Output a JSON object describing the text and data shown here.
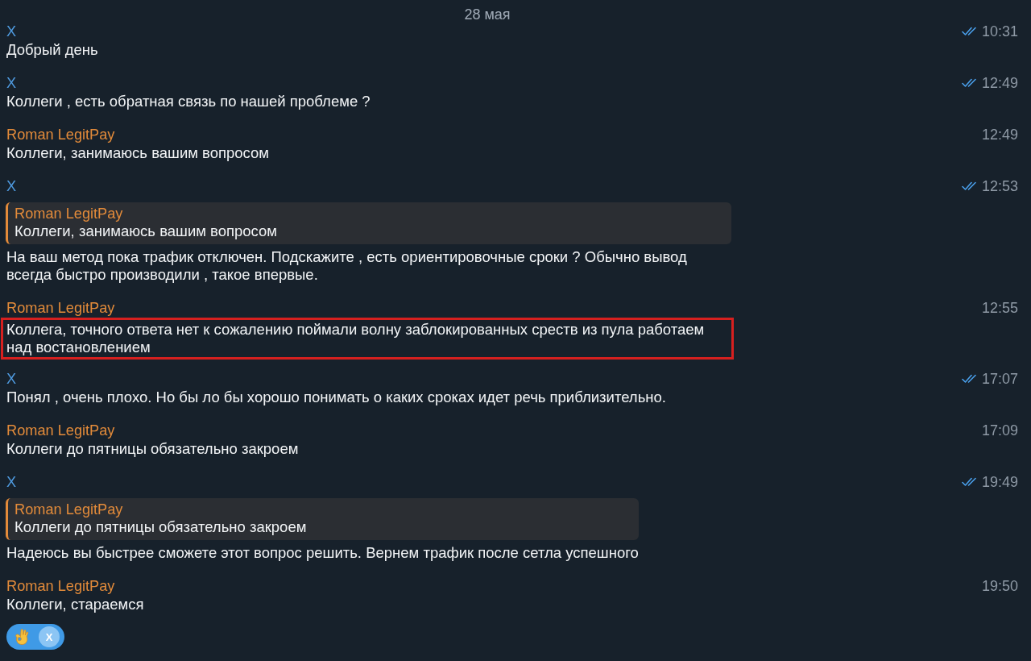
{
  "date_separator": "28 мая",
  "messages": [
    {
      "sender": "X",
      "color": "#4f9be0",
      "time": "10:31",
      "read": true,
      "highlighted": false,
      "text": "Добрый день"
    },
    {
      "sender": "X",
      "color": "#4f9be0",
      "time": "12:49",
      "read": true,
      "highlighted": false,
      "text": "Коллеги , есть обратная связь по нашей проблеме ?"
    },
    {
      "sender": "Roman LegitPay",
      "color": "#e38b3a",
      "time": "12:49",
      "read": false,
      "highlighted": false,
      "text": "Коллеги, занимаюсь вашим вопросом"
    },
    {
      "sender": "X",
      "color": "#4f9be0",
      "time": "12:53",
      "read": true,
      "highlighted": false,
      "reply": {
        "sender": "Roman LegitPay",
        "color": "#e38b3a",
        "text": "Коллеги, занимаюсь вашим вопросом"
      },
      "text": "На ваш метод пока трафик отключен. Подскажите , есть ориентировочные сроки ? Обычно вывод всегда быстро производили , такое впервые."
    },
    {
      "sender": "Roman LegitPay",
      "color": "#e38b3a",
      "time": "12:55",
      "read": false,
      "highlighted": true,
      "text": "Коллега, точного ответа нет к сожалению поймали волну заблокированных среств из пула работаем над востановлением"
    },
    {
      "sender": "X",
      "color": "#4f9be0",
      "time": "17:07",
      "read": true,
      "highlighted": false,
      "text": "Понял , очень плохо. Но бы ло бы хорошо понимать о каких сроках идет речь приблизительно."
    },
    {
      "sender": "Roman LegitPay",
      "color": "#e38b3a",
      "time": "17:09",
      "read": false,
      "highlighted": false,
      "text": "Коллеги до пятницы обязательно закроем"
    },
    {
      "sender": "X",
      "color": "#4f9be0",
      "time": "19:49",
      "read": true,
      "highlighted": false,
      "reply": {
        "sender": "Roman LegitPay",
        "color": "#e38b3a",
        "text": "Коллеги до пятницы обязательно закроем"
      },
      "text": "Надеюсь вы быстрее сможете этот вопрос решить. Вернем трафик после сетла успешного"
    },
    {
      "sender": "Roman LegitPay",
      "color": "#e38b3a",
      "time": "19:50",
      "read": false,
      "highlighted": false,
      "text": "Коллеги, стараемся",
      "reactions": [
        {
          "avatar": "X",
          "selected": true
        }
      ]
    }
  ]
}
